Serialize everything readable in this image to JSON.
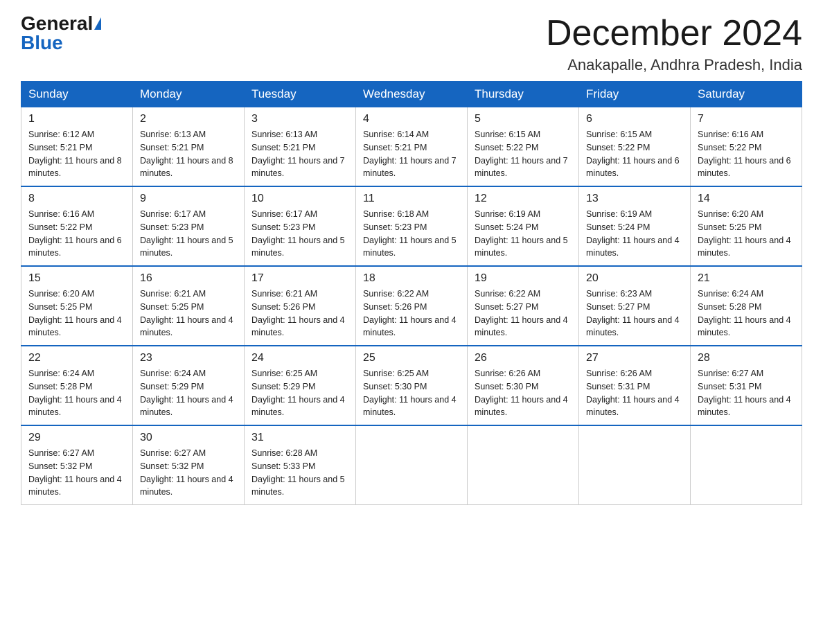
{
  "logo": {
    "general": "General",
    "blue": "Blue"
  },
  "header": {
    "month": "December 2024",
    "location": "Anakapalle, Andhra Pradesh, India"
  },
  "weekdays": [
    "Sunday",
    "Monday",
    "Tuesday",
    "Wednesday",
    "Thursday",
    "Friday",
    "Saturday"
  ],
  "weeks": [
    [
      {
        "day": "1",
        "sunrise": "6:12 AM",
        "sunset": "5:21 PM",
        "daylight": "11 hours and 8 minutes."
      },
      {
        "day": "2",
        "sunrise": "6:13 AM",
        "sunset": "5:21 PM",
        "daylight": "11 hours and 8 minutes."
      },
      {
        "day": "3",
        "sunrise": "6:13 AM",
        "sunset": "5:21 PM",
        "daylight": "11 hours and 7 minutes."
      },
      {
        "day": "4",
        "sunrise": "6:14 AM",
        "sunset": "5:21 PM",
        "daylight": "11 hours and 7 minutes."
      },
      {
        "day": "5",
        "sunrise": "6:15 AM",
        "sunset": "5:22 PM",
        "daylight": "11 hours and 7 minutes."
      },
      {
        "day": "6",
        "sunrise": "6:15 AM",
        "sunset": "5:22 PM",
        "daylight": "11 hours and 6 minutes."
      },
      {
        "day": "7",
        "sunrise": "6:16 AM",
        "sunset": "5:22 PM",
        "daylight": "11 hours and 6 minutes."
      }
    ],
    [
      {
        "day": "8",
        "sunrise": "6:16 AM",
        "sunset": "5:22 PM",
        "daylight": "11 hours and 6 minutes."
      },
      {
        "day": "9",
        "sunrise": "6:17 AM",
        "sunset": "5:23 PM",
        "daylight": "11 hours and 5 minutes."
      },
      {
        "day": "10",
        "sunrise": "6:17 AM",
        "sunset": "5:23 PM",
        "daylight": "11 hours and 5 minutes."
      },
      {
        "day": "11",
        "sunrise": "6:18 AM",
        "sunset": "5:23 PM",
        "daylight": "11 hours and 5 minutes."
      },
      {
        "day": "12",
        "sunrise": "6:19 AM",
        "sunset": "5:24 PM",
        "daylight": "11 hours and 5 minutes."
      },
      {
        "day": "13",
        "sunrise": "6:19 AM",
        "sunset": "5:24 PM",
        "daylight": "11 hours and 4 minutes."
      },
      {
        "day": "14",
        "sunrise": "6:20 AM",
        "sunset": "5:25 PM",
        "daylight": "11 hours and 4 minutes."
      }
    ],
    [
      {
        "day": "15",
        "sunrise": "6:20 AM",
        "sunset": "5:25 PM",
        "daylight": "11 hours and 4 minutes."
      },
      {
        "day": "16",
        "sunrise": "6:21 AM",
        "sunset": "5:25 PM",
        "daylight": "11 hours and 4 minutes."
      },
      {
        "day": "17",
        "sunrise": "6:21 AM",
        "sunset": "5:26 PM",
        "daylight": "11 hours and 4 minutes."
      },
      {
        "day": "18",
        "sunrise": "6:22 AM",
        "sunset": "5:26 PM",
        "daylight": "11 hours and 4 minutes."
      },
      {
        "day": "19",
        "sunrise": "6:22 AM",
        "sunset": "5:27 PM",
        "daylight": "11 hours and 4 minutes."
      },
      {
        "day": "20",
        "sunrise": "6:23 AM",
        "sunset": "5:27 PM",
        "daylight": "11 hours and 4 minutes."
      },
      {
        "day": "21",
        "sunrise": "6:24 AM",
        "sunset": "5:28 PM",
        "daylight": "11 hours and 4 minutes."
      }
    ],
    [
      {
        "day": "22",
        "sunrise": "6:24 AM",
        "sunset": "5:28 PM",
        "daylight": "11 hours and 4 minutes."
      },
      {
        "day": "23",
        "sunrise": "6:24 AM",
        "sunset": "5:29 PM",
        "daylight": "11 hours and 4 minutes."
      },
      {
        "day": "24",
        "sunrise": "6:25 AM",
        "sunset": "5:29 PM",
        "daylight": "11 hours and 4 minutes."
      },
      {
        "day": "25",
        "sunrise": "6:25 AM",
        "sunset": "5:30 PM",
        "daylight": "11 hours and 4 minutes."
      },
      {
        "day": "26",
        "sunrise": "6:26 AM",
        "sunset": "5:30 PM",
        "daylight": "11 hours and 4 minutes."
      },
      {
        "day": "27",
        "sunrise": "6:26 AM",
        "sunset": "5:31 PM",
        "daylight": "11 hours and 4 minutes."
      },
      {
        "day": "28",
        "sunrise": "6:27 AM",
        "sunset": "5:31 PM",
        "daylight": "11 hours and 4 minutes."
      }
    ],
    [
      {
        "day": "29",
        "sunrise": "6:27 AM",
        "sunset": "5:32 PM",
        "daylight": "11 hours and 4 minutes."
      },
      {
        "day": "30",
        "sunrise": "6:27 AM",
        "sunset": "5:32 PM",
        "daylight": "11 hours and 4 minutes."
      },
      {
        "day": "31",
        "sunrise": "6:28 AM",
        "sunset": "5:33 PM",
        "daylight": "11 hours and 5 minutes."
      },
      null,
      null,
      null,
      null
    ]
  ]
}
